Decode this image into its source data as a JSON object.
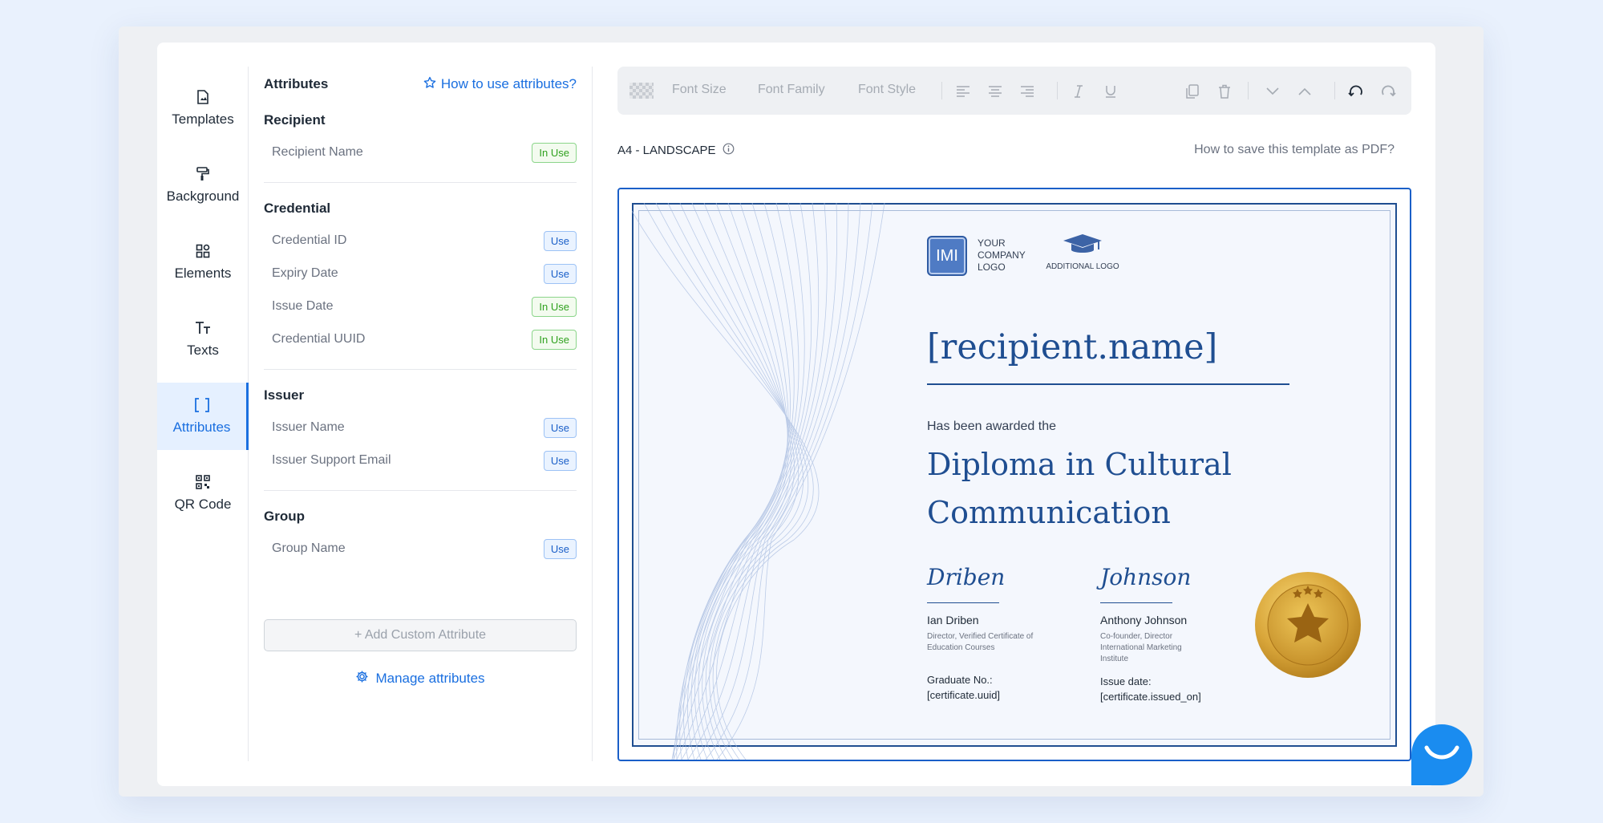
{
  "nav": {
    "items": [
      {
        "label": "Templates",
        "icon": "file-image-icon"
      },
      {
        "label": "Background",
        "icon": "paint-roller-icon"
      },
      {
        "label": "Elements",
        "icon": "shapes-icon"
      },
      {
        "label": "Texts",
        "icon": "text-icon"
      },
      {
        "label": "Attributes",
        "icon": "brackets-icon",
        "active": true
      },
      {
        "label": "QR Code",
        "icon": "qr-code-icon"
      }
    ]
  },
  "attributes": {
    "title": "Attributes",
    "howto": "How to use attributes?",
    "sections": {
      "recipient": {
        "label": "Recipient",
        "rows": [
          {
            "label": "Recipient Name",
            "badge": "In Use"
          }
        ]
      },
      "credential": {
        "label": "Credential",
        "rows": [
          {
            "label": "Credential ID",
            "badge": "Use"
          },
          {
            "label": "Expiry Date",
            "badge": "Use"
          },
          {
            "label": "Issue Date",
            "badge": "In Use"
          },
          {
            "label": "Credential UUID",
            "badge": "In Use"
          }
        ]
      },
      "issuer": {
        "label": "Issuer",
        "rows": [
          {
            "label": "Issuer Name",
            "badge": "Use"
          },
          {
            "label": "Issuer Support Email",
            "badge": "Use"
          }
        ]
      },
      "group": {
        "label": "Group",
        "rows": [
          {
            "label": "Group Name",
            "badge": "Use"
          }
        ]
      }
    },
    "add_custom": "+ Add Custom Attribute",
    "manage": "Manage attributes"
  },
  "toolbar": {
    "font_size": "Font Size",
    "font_family": "Font Family",
    "font_style": "Font Style"
  },
  "canvas": {
    "format": "A4 - LANDSCAPE",
    "save_pdf": "How to save this template as PDF?"
  },
  "certificate": {
    "logo_initials": "IMI",
    "logo_text": "YOUR COMPANY LOGO",
    "additional_logo": "ADDITIONAL LOGO",
    "recipient": "[recipient.name]",
    "awarded": "Has been awarded the",
    "diploma": "Diploma in Cultural Communication",
    "signer1": {
      "signature": "Driben",
      "name": "Ian Driben",
      "role": "Director, Verified Certificate of Education Courses",
      "meta": "Graduate No.: [certificate.uuid]"
    },
    "signer2": {
      "signature": "Johnson",
      "name": "Anthony Johnson",
      "role": "Co-founder, Director International Marketing Institute",
      "meta": "Issue date: [certificate.issued_on]"
    }
  },
  "colors": {
    "accent": "#1a6fe0",
    "certificate_blue": "#1f4e91",
    "in_use_green": "#2fa11e"
  }
}
